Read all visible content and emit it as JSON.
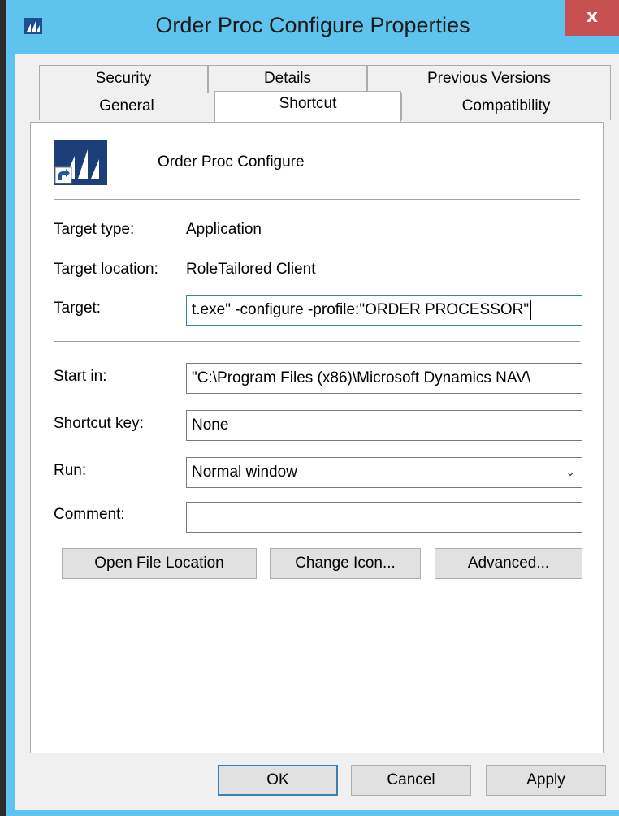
{
  "window": {
    "title": "Order Proc Configure Properties",
    "close_label": "x"
  },
  "tabs_row1": [
    {
      "label": "Security"
    },
    {
      "label": "Details"
    },
    {
      "label": "Previous Versions"
    }
  ],
  "tabs_row2": [
    {
      "label": "General"
    },
    {
      "label": "Shortcut",
      "selected": true
    },
    {
      "label": "Compatibility"
    }
  ],
  "shortcut": {
    "name": "Order Proc Configure",
    "target_type_label": "Target type:",
    "target_type_value": "Application",
    "target_location_label": "Target location:",
    "target_location_value": "RoleTailored Client",
    "target_label": "Target:",
    "target_value": "t.exe\" -configure -profile:\"ORDER PROCESSOR\"",
    "start_in_label": "Start in:",
    "start_in_value": "\"C:\\Program Files (x86)\\Microsoft Dynamics NAV\\",
    "shortcut_key_label": "Shortcut key:",
    "shortcut_key_value": "None",
    "run_label": "Run:",
    "run_value": "Normal window",
    "comment_label": "Comment:",
    "comment_value": ""
  },
  "buttons": {
    "open_file_location": "Open File Location",
    "change_icon": "Change Icon...",
    "advanced": "Advanced...",
    "ok": "OK",
    "cancel": "Cancel",
    "apply": "Apply"
  },
  "colors": {
    "title_bar": "#5ec4ee",
    "close_button": "#c75050",
    "focus_border": "#3c7fb1",
    "icon_bg": "#1c3f7a"
  },
  "icons": {
    "app": "dynamics-nav-icon",
    "shortcut_arrow": "shortcut-arrow-icon",
    "dropdown": "chevron-down-icon"
  }
}
